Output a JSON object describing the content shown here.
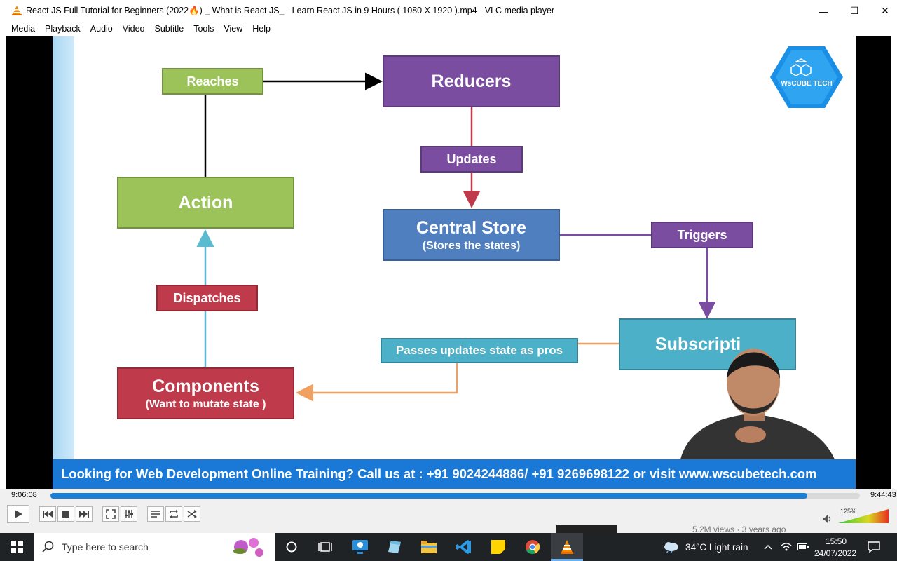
{
  "window": {
    "title": "React JS Full Tutorial for Beginners (2022🔥) _ What is React JS_ - Learn React JS in 9 Hours ( 1080 X 1920 ).mp4 - VLC media player",
    "controls": {
      "minimize": "—",
      "maximize": "☐",
      "close": "✕"
    }
  },
  "menu": [
    "Media",
    "Playback",
    "Audio",
    "Video",
    "Subtitle",
    "Tools",
    "View",
    "Help"
  ],
  "slide": {
    "boxes": {
      "reaches": "Reaches",
      "reducers": "Reducers",
      "updates": "Updates",
      "action": "Action",
      "central_store": "Central Store",
      "central_store_sub": "(Stores the states)",
      "triggers": "Triggers",
      "dispatches": "Dispatches",
      "passes": "Passes updates state as pros",
      "subscription": "Subscripti",
      "components": "Components",
      "components_sub": "(Want to mutate state )"
    },
    "logo_text": "WsCUBE TECH",
    "banner": "Looking for Web Development Online Training? Call us at : +91 9024244886/ +91 9269698122 or visit www.wscubetech.com",
    "colors": {
      "green": "#9bc35a",
      "purple": "#7b4da0",
      "blue": "#4f7fbf",
      "red": "#bf3a4a",
      "teal": "#4bb0c8",
      "banner": "#1a78d6"
    }
  },
  "player": {
    "elapsed": "9:06:08",
    "total": "9:44:43",
    "progress_fraction": 0.935,
    "volume_label": "125%",
    "volume_fraction": 1.0,
    "buttons": [
      "play-icon",
      "previous-icon",
      "stop-icon",
      "next-icon",
      "fullscreen-icon",
      "extended-settings-icon",
      "playlist-icon",
      "loop-icon",
      "random-icon"
    ]
  },
  "background_peek": {
    "views": "5.2M views · 3 years ago"
  },
  "taskbar": {
    "search_placeholder": "Type here to search",
    "weather": "34°C  Light rain",
    "time": "15:50",
    "date": "24/07/2022"
  }
}
